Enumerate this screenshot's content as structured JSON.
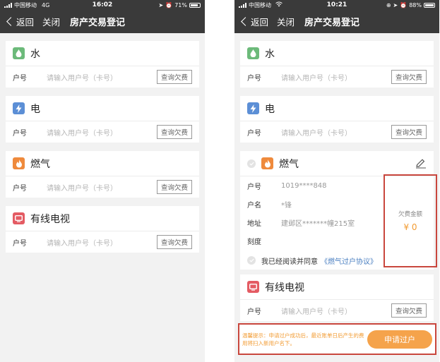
{
  "left": {
    "status": {
      "carrier": "中国移动",
      "network": "4G",
      "time": "16:02",
      "battery": "71%",
      "battery_level": 0.71
    },
    "nav": {
      "back": "返回",
      "close": "关闭",
      "title": "房产交易登记"
    },
    "services": [
      {
        "name": "水",
        "row_label": "户号",
        "placeholder": "请输入用户号（卡号）",
        "query": "查询欠费"
      },
      {
        "name": "电",
        "row_label": "户号",
        "placeholder": "请输入用户号（卡号）",
        "query": "查询欠费"
      },
      {
        "name": "燃气",
        "row_label": "户号",
        "placeholder": "请输入用户号（卡号）",
        "query": "查询欠费"
      },
      {
        "name": "有线电视",
        "row_label": "户号",
        "placeholder": "请输入用户号（卡号）",
        "query": "查询欠费"
      }
    ]
  },
  "right": {
    "status": {
      "carrier": "中国移动",
      "time": "10:21",
      "battery": "88%",
      "battery_level": 0.88
    },
    "nav": {
      "back": "返回",
      "close": "关闭",
      "title": "房产交易登记"
    },
    "water": {
      "name": "水",
      "row_label": "户号",
      "placeholder": "请输入用户号（卡号）",
      "query": "查询欠费"
    },
    "electric": {
      "name": "电",
      "row_label": "户号",
      "placeholder": "请输入用户号（卡号）",
      "query": "查询欠费"
    },
    "gas": {
      "name": "燃气",
      "rows": [
        {
          "label": "户号",
          "value": "1019****848"
        },
        {
          "label": "户名",
          "value": "*锋"
        },
        {
          "label": "地址",
          "value": "建邺区*******幢215室"
        },
        {
          "label": "刻度",
          "value": ""
        }
      ],
      "agree_text": "我已经阅读并同意",
      "agree_link": "《燃气过户协议》"
    },
    "debt": {
      "label": "欠费金额",
      "value": "¥ 0"
    },
    "tv": {
      "name": "有线电视",
      "row_label": "户号",
      "placeholder": "请输入用户号（卡号）",
      "query": "查询欠费"
    },
    "footer": {
      "tip": "温馨提示：申请过户成功后，最近账单日后产生的费用将扫入新用户名下。",
      "apply": "申请过户"
    }
  },
  "colors": {
    "water": "#6cba7a",
    "electric": "#5c8fd6",
    "gas": "#ef8a3c",
    "tv": "#e45b63",
    "highlight": "#c9463d",
    "accent": "#f5a34b"
  }
}
